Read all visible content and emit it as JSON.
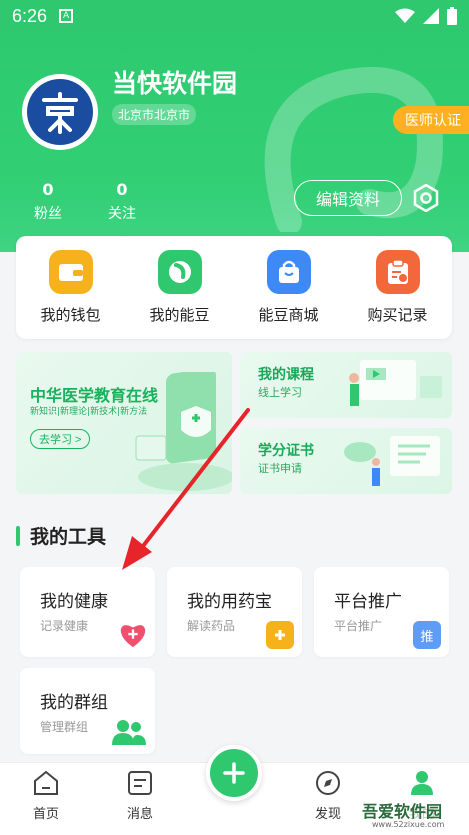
{
  "status_bar": {
    "time": "6:26",
    "sim_label": "A"
  },
  "profile": {
    "name": "当快软件园",
    "location": "北京市北京市",
    "doctor_badge": "医师认证",
    "fans_count": "0",
    "fans_label": "粉丝",
    "follow_count": "0",
    "follow_label": "关注",
    "edit_button": "编辑资料"
  },
  "quick_actions": [
    {
      "label": "我的钱包",
      "icon": "wallet-icon",
      "color": "#f6b21b"
    },
    {
      "label": "我的能豆",
      "icon": "bean-icon",
      "color": "#2fc86f"
    },
    {
      "label": "能豆商城",
      "icon": "shopping-bag-icon",
      "color": "#3d8af7"
    },
    {
      "label": "购买记录",
      "icon": "clipboard-icon",
      "color": "#f2683a"
    }
  ],
  "banners": {
    "education": {
      "title": "中华医学教育在线",
      "subtitle": "新知识|新理论|新技术|新方法",
      "button": "去学习 >"
    },
    "course": {
      "title": "我的课程",
      "subtitle": "线上学习"
    },
    "certificate": {
      "title": "学分证书",
      "subtitle": "证书申请"
    }
  },
  "tools_section": {
    "title": "我的工具"
  },
  "tools": [
    {
      "title": "我的健康",
      "subtitle": "记录健康",
      "icon": "heart-plus-icon",
      "color": "#f04f6e"
    },
    {
      "title": "我的用药宝",
      "subtitle": "解读药品",
      "icon": "medicine-box-icon",
      "color": "#f6b21b"
    },
    {
      "title": "平台推广",
      "subtitle": "平台推广",
      "icon": "promote-icon",
      "color": "#5e9cf5",
      "glyph": "推"
    },
    {
      "title": "我的群组",
      "subtitle": "管理群组",
      "icon": "group-icon",
      "color": "#2fc86f"
    }
  ],
  "tabbar": {
    "home": "首页",
    "messages": "消息",
    "discover": "发现",
    "mine": "我的"
  },
  "watermark": {
    "text": "吾爱软件园",
    "url": "www.52zixue.com"
  },
  "colors": {
    "primary": "#2fc86f",
    "badge": "#ffb020",
    "arrow": "#e8242b"
  }
}
